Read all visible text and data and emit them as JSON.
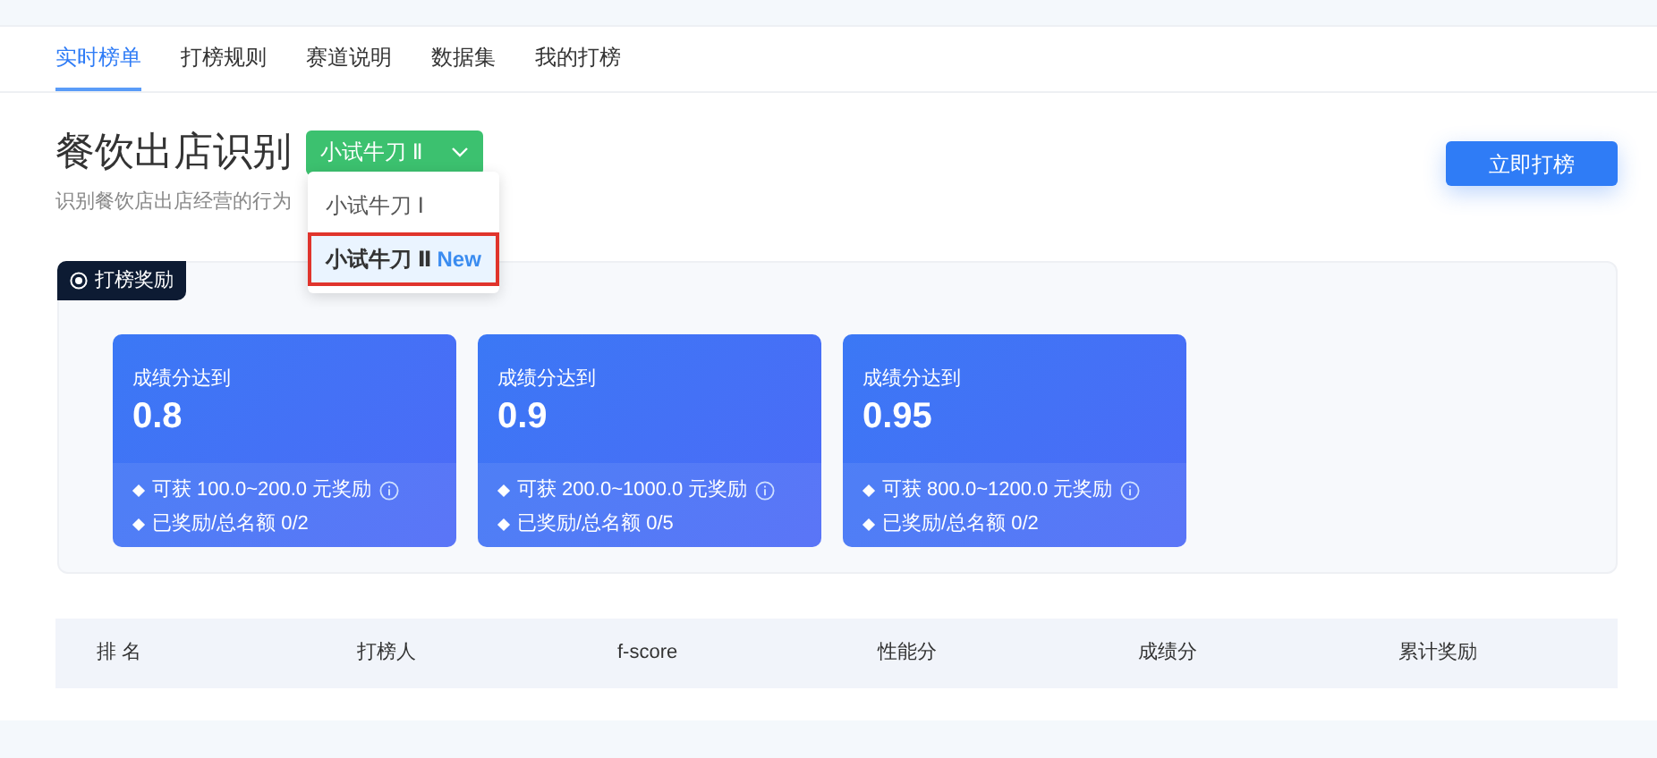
{
  "tabs": [
    {
      "label": "实时榜单",
      "selected": true
    },
    {
      "label": "打榜规则",
      "selected": false
    },
    {
      "label": "赛道说明",
      "selected": false
    },
    {
      "label": "数据集",
      "selected": false
    },
    {
      "label": "我的打榜",
      "selected": false
    }
  ],
  "title": "餐饮出店识别",
  "level_select": {
    "value": "小试牛刀 Ⅱ",
    "expanded": true,
    "options": [
      {
        "label": "小试牛刀 Ⅰ",
        "selected": false
      },
      {
        "label": "小试牛刀 Ⅱ",
        "tag": "New",
        "selected": true
      }
    ]
  },
  "subtitle": "识别餐饮店出店经营的行为",
  "submit_button": "立即打榜",
  "rewards": {
    "badge": "打榜奖励",
    "cards": [
      {
        "label": "成绩分达到",
        "score": "0.8",
        "prize": "可获 100.0~200.0 元奖励",
        "quota": "已奖励/总名额 0/2"
      },
      {
        "label": "成绩分达到",
        "score": "0.9",
        "prize": "可获 200.0~1000.0 元奖励",
        "quota": "已奖励/总名额 0/5"
      },
      {
        "label": "成绩分达到",
        "score": "0.95",
        "prize": "可获 800.0~1200.0 元奖励",
        "quota": "已奖励/总名额 0/2"
      }
    ]
  },
  "table": {
    "columns": [
      "排 名",
      "打榜人",
      "f-score",
      "性能分",
      "成绩分",
      "累计奖励"
    ]
  }
}
